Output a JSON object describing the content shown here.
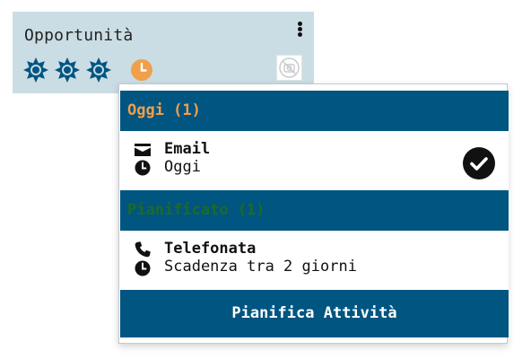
{
  "card": {
    "title": "Opportunità",
    "menu_icon": "vertical-dots-icon",
    "priority_icons": [
      "star-badge-icon",
      "star-badge-icon",
      "star-badge-icon"
    ],
    "activity_icon": "clock-icon",
    "avatar_icon": "no-photo-icon",
    "colors": {
      "background": "#cbdde4",
      "badge": "#005581",
      "clock": "#f0a04b"
    }
  },
  "popup": {
    "today_header": "Oggi (1)",
    "planned_header": "Pianificato (1)",
    "activities": [
      {
        "icon": "envelope-icon",
        "title": "Email",
        "due_icon": "clock-icon",
        "due": "Oggi",
        "done": true
      },
      {
        "icon": "phone-icon",
        "title": "Telefonata",
        "due_icon": "clock-icon",
        "due": "Scadenza tra 2 giorni",
        "done": false
      }
    ],
    "schedule_button": "Pianifica Attività",
    "colors": {
      "header_bg": "#005581",
      "today_text": "#f0a04b",
      "planned_text": "#1e6b24"
    }
  }
}
